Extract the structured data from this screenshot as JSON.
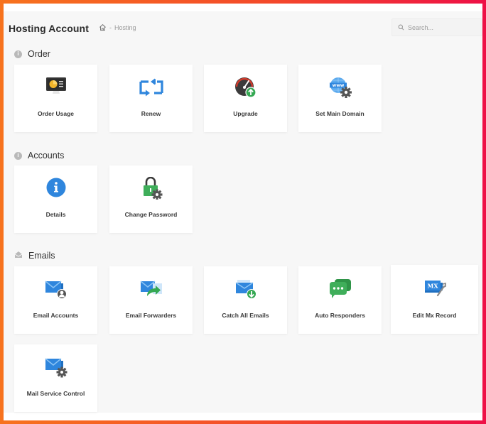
{
  "header": {
    "title": "Hosting Account",
    "breadcrumb": {
      "home_icon": "home-icon",
      "separator": "-",
      "current": "Hosting"
    },
    "search": {
      "placeholder": "Search...",
      "value": "",
      "icon": "search-icon"
    }
  },
  "sections": [
    {
      "title": "Order",
      "icon": "info-circle-icon",
      "items": [
        {
          "label": "Order Usage",
          "icon": "monitor-chart-icon"
        },
        {
          "label": "Renew",
          "icon": "renew-arrows-icon"
        },
        {
          "label": "Upgrade",
          "icon": "speedometer-upgrade-icon"
        },
        {
          "label": "Set Main Domain",
          "icon": "globe-www-gear-icon"
        }
      ]
    },
    {
      "title": "Accounts",
      "icon": "info-circle-icon",
      "items": [
        {
          "label": "Details",
          "icon": "info-icon"
        },
        {
          "label": "Change Password",
          "icon": "lock-gear-icon"
        }
      ]
    },
    {
      "title": "Emails",
      "icon": "open-envelope-icon",
      "items": [
        {
          "label": "Email Accounts",
          "icon": "envelope-user-icon"
        },
        {
          "label": "Email Forwarders",
          "icon": "envelope-forward-icon"
        },
        {
          "label": "Catch All Emails",
          "icon": "envelope-download-icon"
        },
        {
          "label": "Auto Responders",
          "icon": "chat-bubbles-icon"
        },
        {
          "label": "Edit Mx Record",
          "icon": "mx-wrench-icon"
        },
        {
          "label": "Mail Service Control",
          "icon": "envelope-gear-icon"
        }
      ]
    }
  ],
  "colors": {
    "frame_gradient_start": "#f7731e",
    "frame_gradient_end": "#ee1046",
    "icon_blue": "#2f86dd",
    "icon_green": "#35a853",
    "icon_dark": "#3d3d3d",
    "page_bg": "#f7f7f7"
  }
}
